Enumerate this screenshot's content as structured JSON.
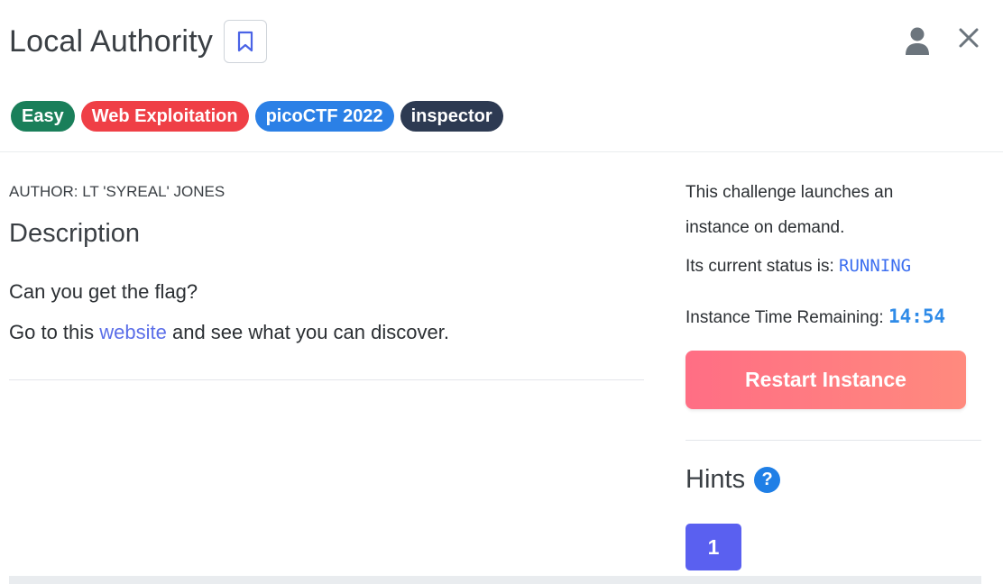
{
  "header": {
    "title": "Local Authority",
    "bookmark_icon": "bookmark-icon",
    "user_icon": "user-icon",
    "close_icon": "close-icon",
    "tags": [
      {
        "label": "Easy",
        "color": "#1a7f5a"
      },
      {
        "label": "Web Exploitation",
        "color": "#ef3f46"
      },
      {
        "label": "picoCTF 2022",
        "color": "#2b80e6"
      },
      {
        "label": "inspector",
        "color": "#2d3a52"
      }
    ]
  },
  "main": {
    "author": "AUTHOR: LT 'SYREAL' JONES",
    "description_heading": "Description",
    "description_line1": "Can you get the flag?",
    "description_line2_prefix": "Go to this ",
    "description_link": "website",
    "description_line2_suffix": " and see what you can discover."
  },
  "instance": {
    "launch_line1": "This challenge launches an",
    "launch_line2": "instance on demand.",
    "status_label": "Its current status is: ",
    "status_value": "RUNNING",
    "time_label": "Instance Time Remaining: ",
    "time_value": "14:54",
    "restart_label": "Restart Instance"
  },
  "hints": {
    "title": "Hints",
    "help_icon_glyph": "?",
    "items": [
      "1"
    ]
  },
  "colors": {
    "accent": "#5a60f0",
    "link": "#5b6ee8",
    "restart_gradient_start": "#ff6e84",
    "restart_gradient_end": "#ff8a7e"
  }
}
